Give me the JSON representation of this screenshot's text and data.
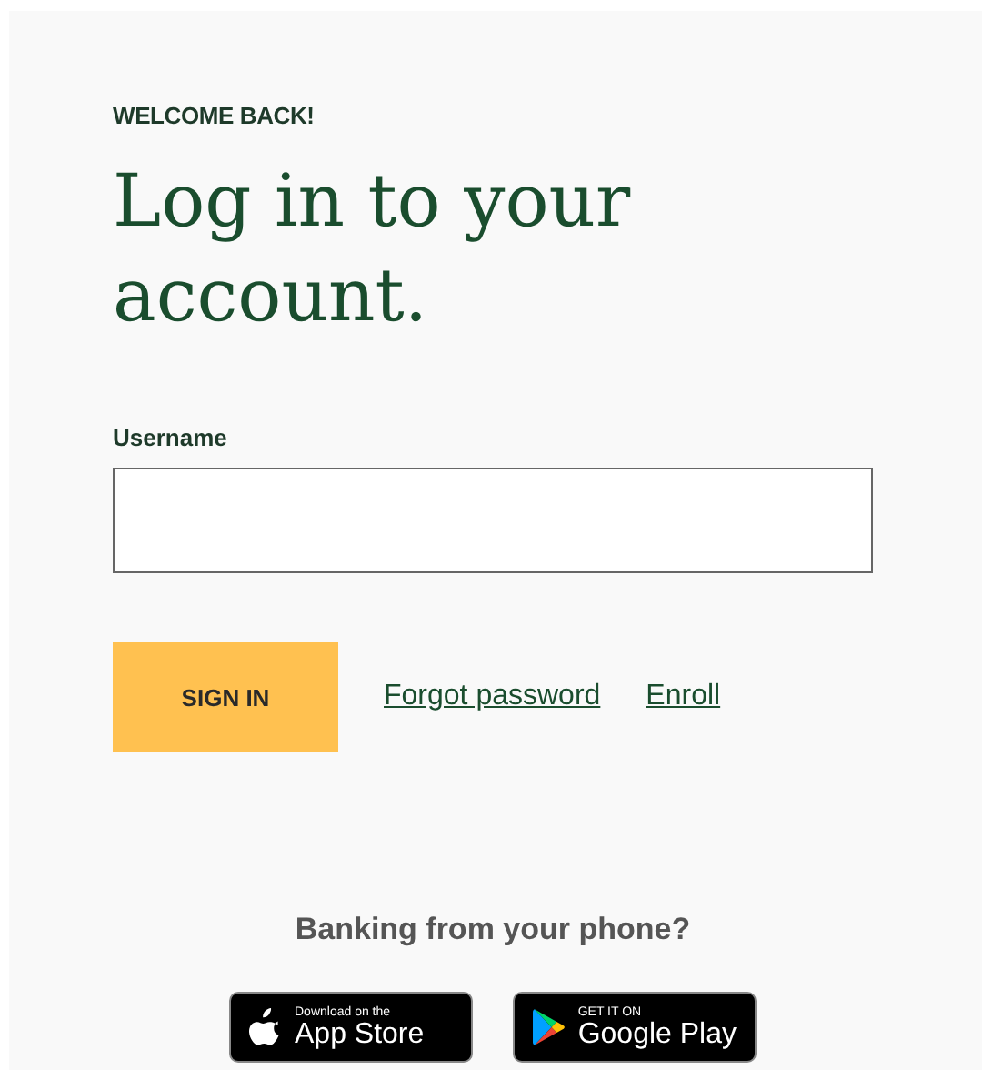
{
  "eyebrow": "WELCOME BACK!",
  "heading": "Log in to your account.",
  "username": {
    "label": "Username"
  },
  "sign_in": "SIGN IN",
  "links": [
    "Forgot password",
    "Enroll"
  ],
  "app_promo": "Banking from your phone?",
  "badges": [
    {
      "kind": "apple",
      "small": "Download on the",
      "big": "App Store"
    },
    {
      "kind": "google",
      "small": "GET IT ON",
      "big": "Google Play"
    }
  ]
}
